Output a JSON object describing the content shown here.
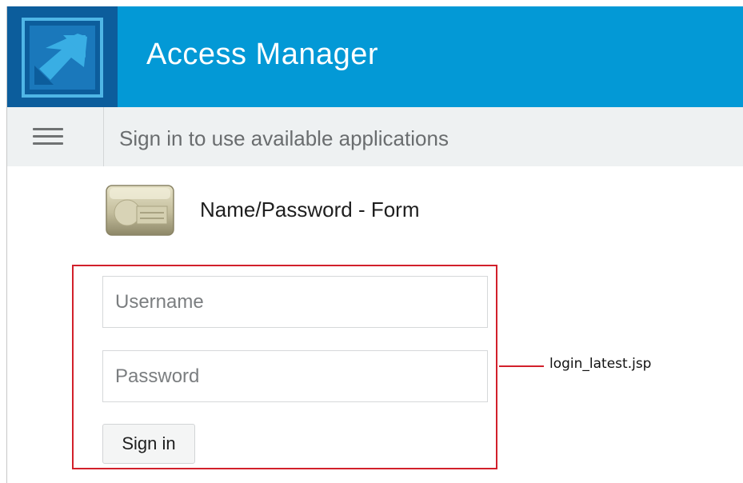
{
  "header": {
    "title": "Access Manager",
    "logo_icon": "access-manager-logo-icon",
    "brand_color": "#0399d6",
    "logo_bg": "#0c5d9c"
  },
  "subbar": {
    "menu_icon": "hamburger-menu-icon",
    "message": "Sign in to use available applications"
  },
  "auth_method": {
    "icon": "id-card-icon",
    "title": "Name/Password - Form"
  },
  "form": {
    "username_placeholder": "Username",
    "password_placeholder": "Password",
    "signin_label": "Sign in"
  },
  "annotation": {
    "label": "login_latest.jsp",
    "color": "#d2202b"
  }
}
